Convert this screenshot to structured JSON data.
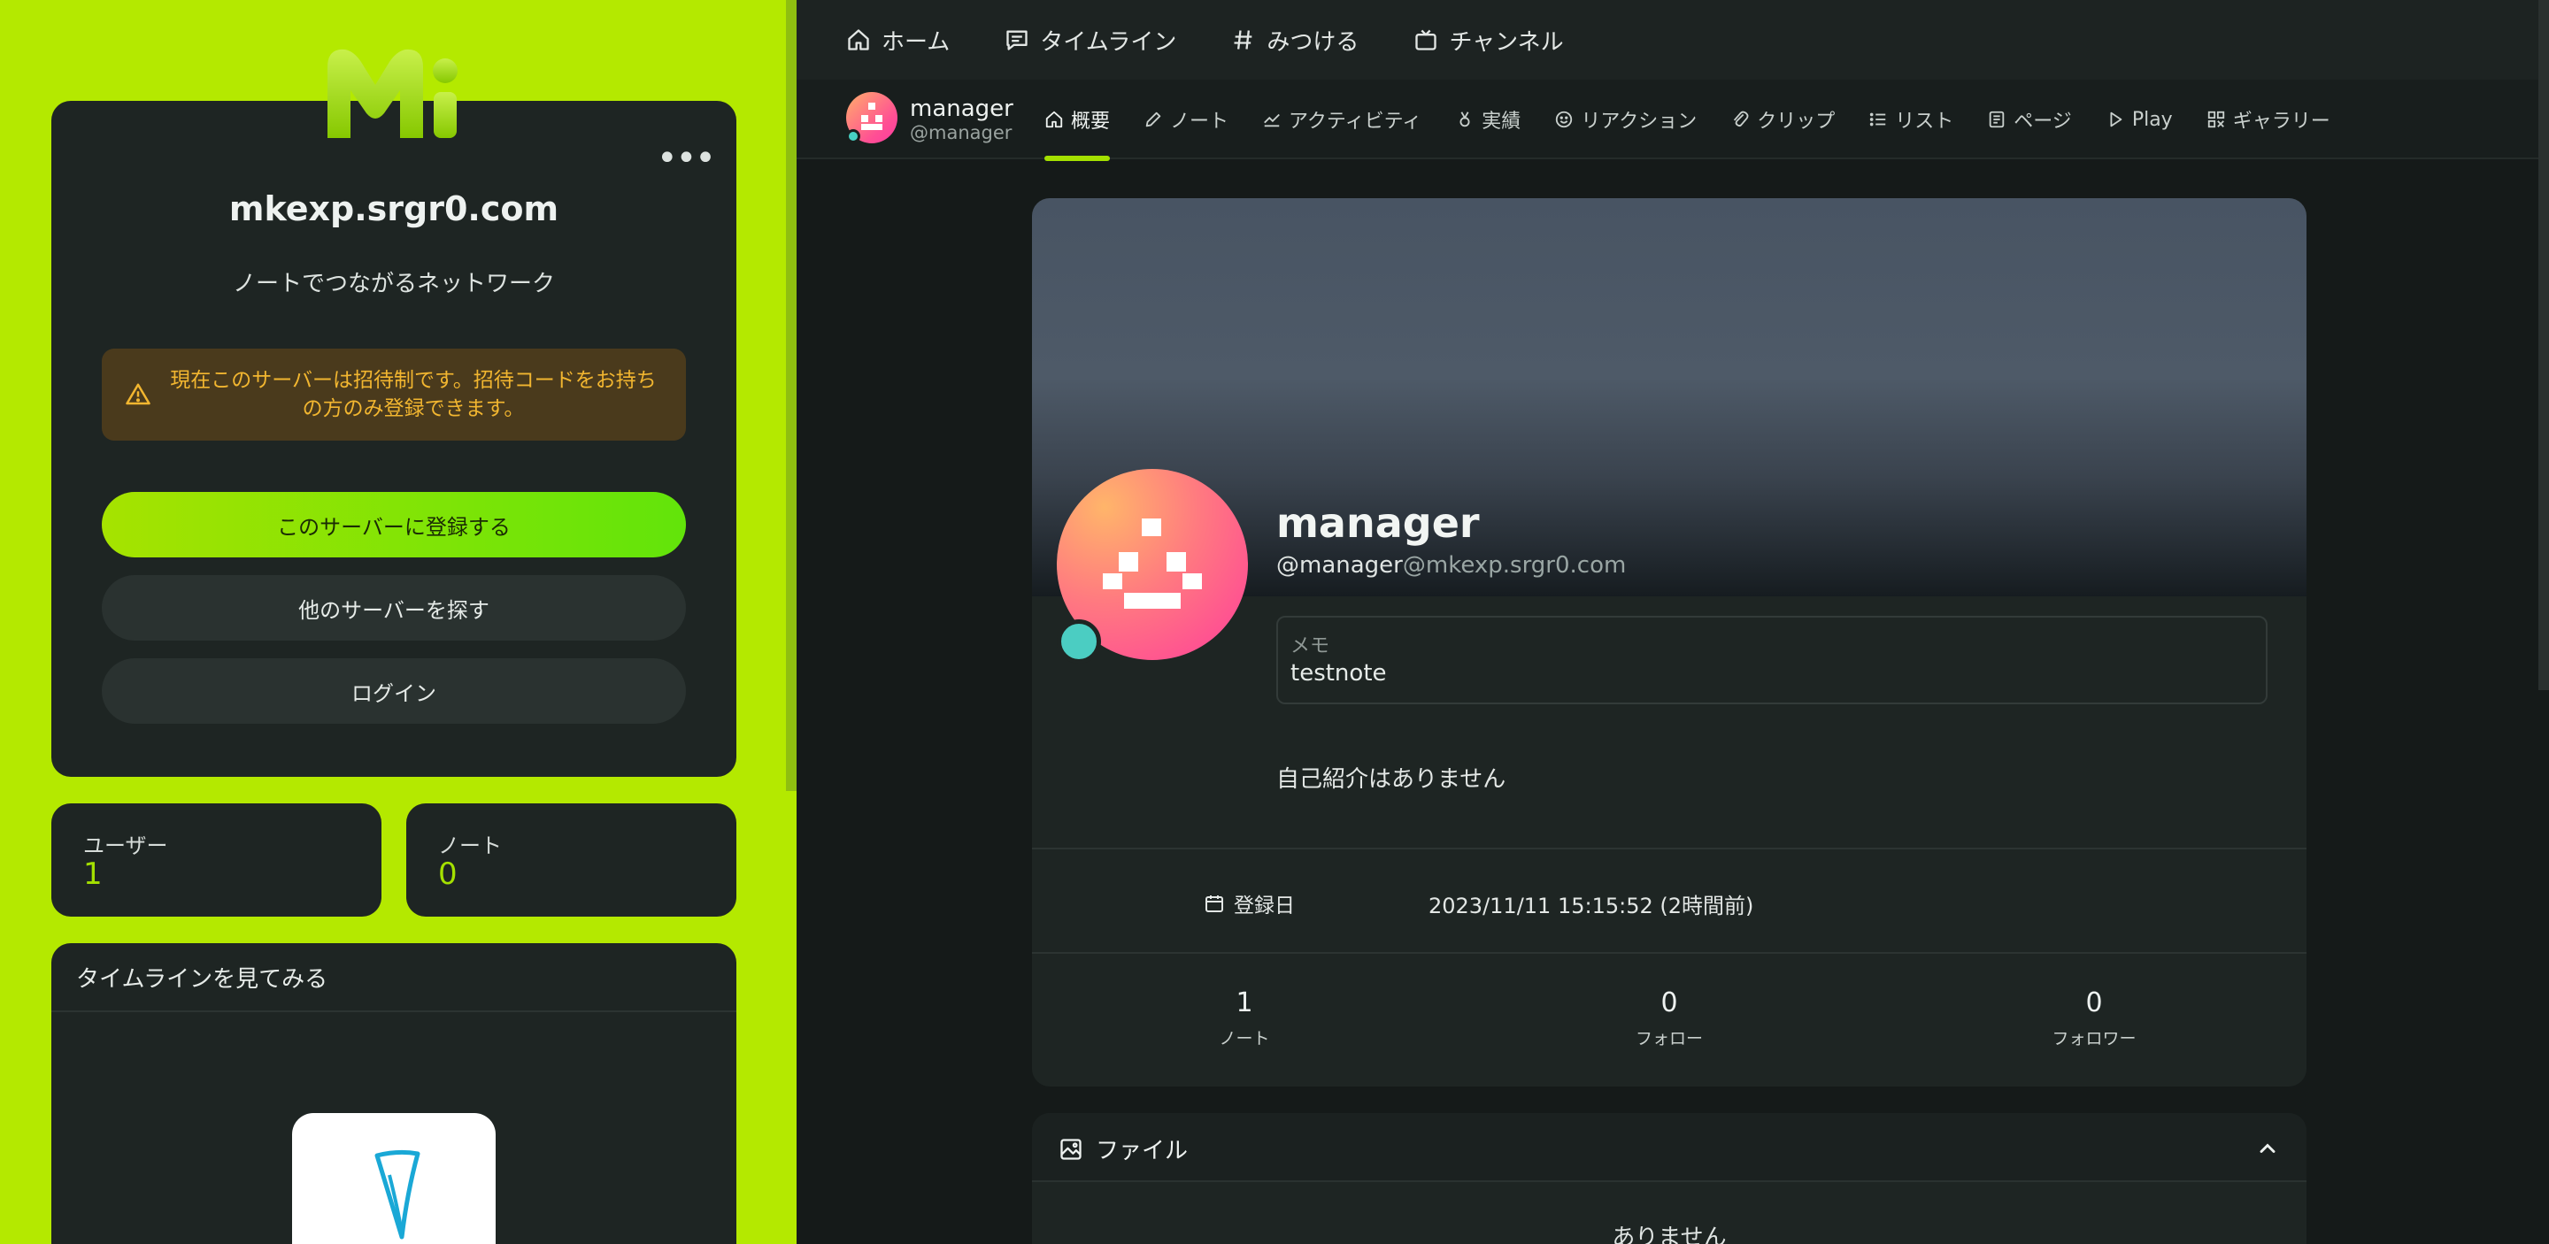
{
  "left": {
    "server_name": "mkexp.srgr0.com",
    "tagline": "ノートでつながるネットワーク",
    "notice": "現在このサーバーは招待制です。招待コードをお持ちの方のみ登録できます。",
    "signup_label": "このサーバーに登録する",
    "explore_label": "他のサーバーを探す",
    "login_label": "ログイン",
    "stats": {
      "users_label": "ユーザー",
      "users_value": "1",
      "notes_label": "ノート",
      "notes_value": "0"
    },
    "timeline_title": "タイムラインを見てみる"
  },
  "topnav": {
    "home": "ホーム",
    "timeline": "タイムライン",
    "explore": "みつける",
    "channel": "チャンネル"
  },
  "subnav": {
    "user_name": "manager",
    "user_handle": "@manager",
    "tabs": {
      "overview": "概要",
      "notes": "ノート",
      "activity": "アクティビティ",
      "achievements": "実績",
      "reactions": "リアクション",
      "clips": "クリップ",
      "lists": "リスト",
      "pages": "ページ",
      "play": "Play",
      "gallery": "ギャラリー"
    }
  },
  "profile": {
    "name": "manager",
    "handle_user": "@manager",
    "handle_host": "@mkexp.srgr0.com",
    "memo_label": "メモ",
    "memo_text": "testnote",
    "bio": "自己紹介はありません",
    "joined_label": "登録日",
    "joined_value": "2023/11/11 15:15:52 (2時間前)",
    "notes_count": "1",
    "notes_label": "ノート",
    "following_count": "0",
    "following_label": "フォロー",
    "followers_count": "0",
    "followers_label": "フォロワー"
  },
  "files": {
    "title": "ファイル",
    "empty": "ありません"
  },
  "colors": {
    "accent": "#a4e000",
    "panel_bg": "#b4e900",
    "notice_text": "#f2b630",
    "online": "#4bcdc2"
  }
}
